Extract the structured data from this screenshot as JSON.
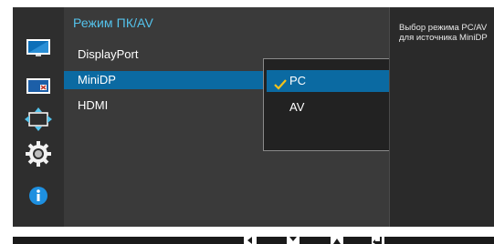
{
  "colors": {
    "osd_background": "#2c2c2c",
    "menu_panel": "#3a3a3a",
    "accent_title": "#54c3ec",
    "selection": "#0b6aa2",
    "check_mark": "#f2c21b"
  },
  "sidebar": {
    "items": [
      {
        "icon": "monitor-picture-icon"
      },
      {
        "icon": "monitor-color-icon"
      },
      {
        "icon": "resize-arrows-icon"
      },
      {
        "icon": "settings-gear-icon"
      },
      {
        "icon": "info-icon"
      }
    ]
  },
  "menu": {
    "title": "Режим ПК/AV",
    "items": [
      {
        "label": "DisplayPort"
      },
      {
        "label": "MiniDP"
      },
      {
        "label": "HDMI"
      }
    ],
    "selected_item": "MiniDP"
  },
  "dropdown": {
    "options": [
      {
        "label": "PC",
        "checked": true
      },
      {
        "label": "AV",
        "checked": false
      }
    ]
  },
  "help": {
    "text": "Выбор режима PC/AV\nдля источника MiniDP"
  },
  "bottom_bar": {
    "icons": [
      "left-arrow-icon",
      "down-arrow-icon",
      "up-arrow-icon",
      "enter-icon"
    ]
  }
}
